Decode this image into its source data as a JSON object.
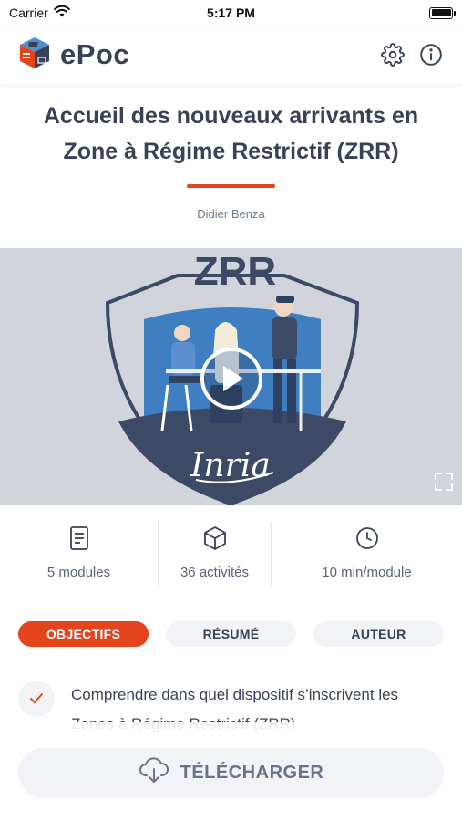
{
  "status_bar": {
    "carrier": "Carrier",
    "time": "5:17 PM",
    "icons": [
      "wifi-icon",
      "battery-icon"
    ]
  },
  "header": {
    "app_name": "ePoc",
    "icons": [
      "logo-icon",
      "settings-icon",
      "info-icon"
    ]
  },
  "course": {
    "title": "Accueil des nouveaux arrivants en Zone à Régime Restrictif (ZRR)",
    "author": "Didier Benza"
  },
  "video": {
    "thumbnail_text": "ZRR",
    "thumbnail_logo": "Inria",
    "icons": [
      "play-icon",
      "fullscreen-icon"
    ]
  },
  "stats": [
    {
      "icon": "document-icon",
      "label": "5 modules"
    },
    {
      "icon": "cube-icon",
      "label": "36 activités"
    },
    {
      "icon": "clock-icon",
      "label": "10 min/module"
    }
  ],
  "tabs": [
    {
      "label": "OBJECTIFS",
      "active": true
    },
    {
      "label": "RÉSUMÉ",
      "active": false
    },
    {
      "label": "AUTEUR",
      "active": false
    }
  ],
  "objectives": [
    {
      "icon": "check-icon",
      "text": "Comprendre dans quel dispositif s’inscrivent les Zones à Régime Restrictif (ZRR)"
    }
  ],
  "download": {
    "label": "TÉLÉCHARGER",
    "icon": "cloud-download-icon"
  },
  "colors": {
    "accent": "#e4441c",
    "text_primary": "#384257",
    "chip_bg": "#f1f3f6",
    "video_bg": "#d1d4da",
    "shield_blue": "#3d7fc1",
    "shield_navy": "#3c4a66"
  }
}
